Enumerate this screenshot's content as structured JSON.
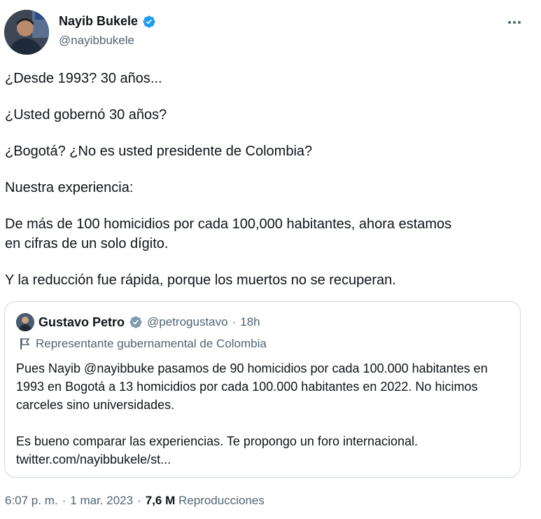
{
  "author": {
    "name": "Nayib Bukele",
    "handle": "@nayibbukele",
    "verified_icon": "verified-badge-icon"
  },
  "tweet": {
    "paragraphs": [
      "¿Desde 1993? 30 años...",
      "¿Usted gobernó 30 años?",
      "¿Bogotá? ¿No es usted presidente de Colombia?",
      "Nuestra experiencia:",
      "De más de 100 homicidios por cada 100,000 habitantes, ahora estamos\nen cifras de un solo dígito.",
      "Y la reducción fue rápida, porque los muertos no se recuperan."
    ]
  },
  "quote": {
    "name": "Gustavo Petro",
    "handle": "@petrogustavo",
    "separator": "·",
    "time": "18h",
    "label": "Representante gubernamental de Colombia",
    "text_1": "Pues Nayib @nayibbuke pasamos de 90 homicidios por cada 100.000 habitantes en 1993 en Bogotá  a 13 homicidios por cada 100.000 habitantes en 2022. No hicimos carceles sino universidades.",
    "text_2": "Es bueno comparar las experiencias. Te propongo un foro internacional.",
    "link": "twitter.com/nayibbukele/st..."
  },
  "meta": {
    "time": "6:07 p. m.",
    "sep": "·",
    "date": "1 mar. 2023",
    "sep2": "·",
    "views_count": "7,6 M",
    "views_label": "Reproducciones"
  },
  "colors": {
    "verified": "#1d9bf0",
    "text": "#0f1419",
    "secondary": "#536471",
    "border": "#cfd9de"
  }
}
